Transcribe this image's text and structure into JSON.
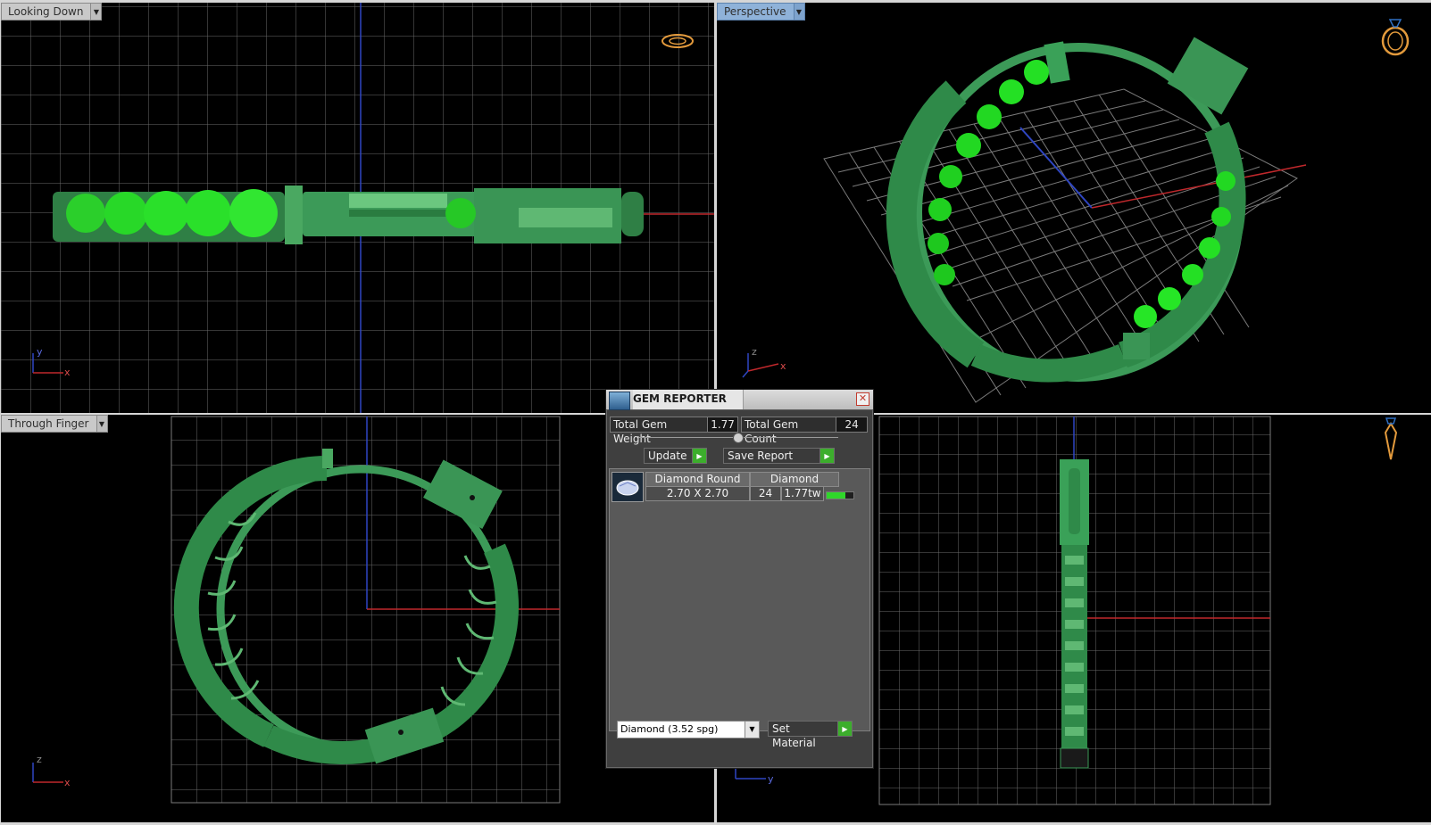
{
  "viewports": {
    "top_left": {
      "label": "Looking Down",
      "axes": [
        "y",
        "x"
      ]
    },
    "top_right": {
      "label": "Perspective",
      "axes": [
        "z",
        "x"
      ]
    },
    "bottom_left": {
      "label": "Through Finger",
      "axes": [
        "z",
        "x"
      ]
    },
    "bottom_right": {
      "label": "",
      "axes": [
        "y"
      ]
    }
  },
  "icons": {
    "top_left": "ring-top-view-icon",
    "top_right": "ring-perspective-icon",
    "bottom_right": "ring-side-view-icon"
  },
  "gem_reporter": {
    "title": "GEM REPORTER",
    "total_gem_weight_label": "Total Gem Weight",
    "total_gem_weight": "1.77",
    "total_gem_count_label": "Total Gem Count",
    "total_gem_count": "24",
    "update_label": "Update",
    "save_report_label": "Save Report",
    "gems": [
      {
        "shape": "Diamond Round",
        "size": "2.70 X 2.70",
        "material": "Diamond",
        "count": "24",
        "weight": "1.77tw",
        "fill": 0.7
      }
    ],
    "material_select": "Diamond    (3.52 spg)",
    "set_material_label": "Set Material"
  },
  "colors": {
    "background": "#000000",
    "grid": "#6a6a6a",
    "model_green": "#3c9a58",
    "gem_green": "#20e020",
    "axis_red": "#c0282c",
    "axis_blue": "#2f46c2",
    "icon_orange": "#e39a3c"
  }
}
